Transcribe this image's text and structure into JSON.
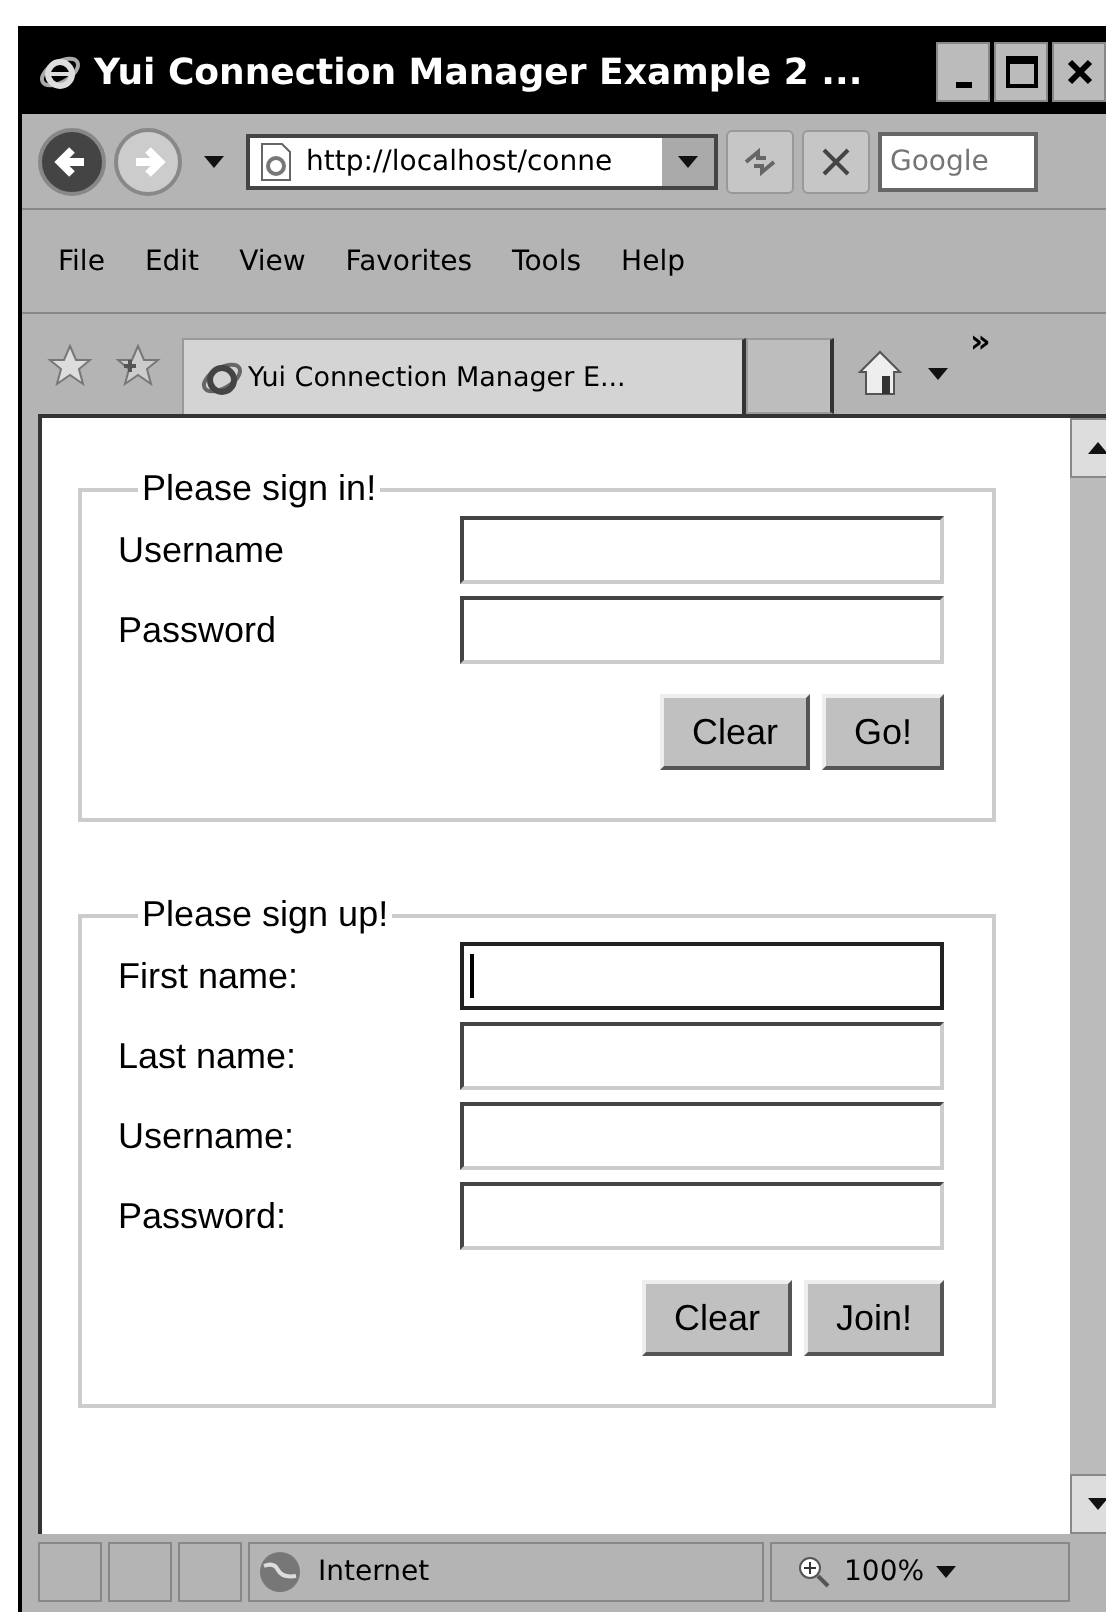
{
  "window": {
    "title": "Yui Connection Manager Example 2 ..."
  },
  "address_bar": {
    "value": "http://localhost/conne"
  },
  "search": {
    "placeholder": "Google"
  },
  "menu": [
    "File",
    "Edit",
    "View",
    "Favorites",
    "Tools",
    "Help"
  ],
  "tabs": [
    {
      "label": "Yui Connection Manager E...",
      "selected": true
    }
  ],
  "chevron": "»",
  "forms": [
    {
      "legend": "Please sign in!",
      "fields": [
        {
          "label": "Username",
          "focused": false
        },
        {
          "label": "Password",
          "focused": false
        }
      ],
      "buttons": [
        "Clear",
        "Go!"
      ]
    },
    {
      "legend": "Please sign up!",
      "fields": [
        {
          "label": "First name:",
          "focused": true
        },
        {
          "label": "Last name:",
          "focused": false
        },
        {
          "label": "Username:",
          "focused": false
        },
        {
          "label": "Password:",
          "focused": false
        }
      ],
      "buttons": [
        "Clear",
        "Join!"
      ]
    }
  ],
  "status_bar": {
    "zone": "Internet",
    "zoom": "100%"
  }
}
